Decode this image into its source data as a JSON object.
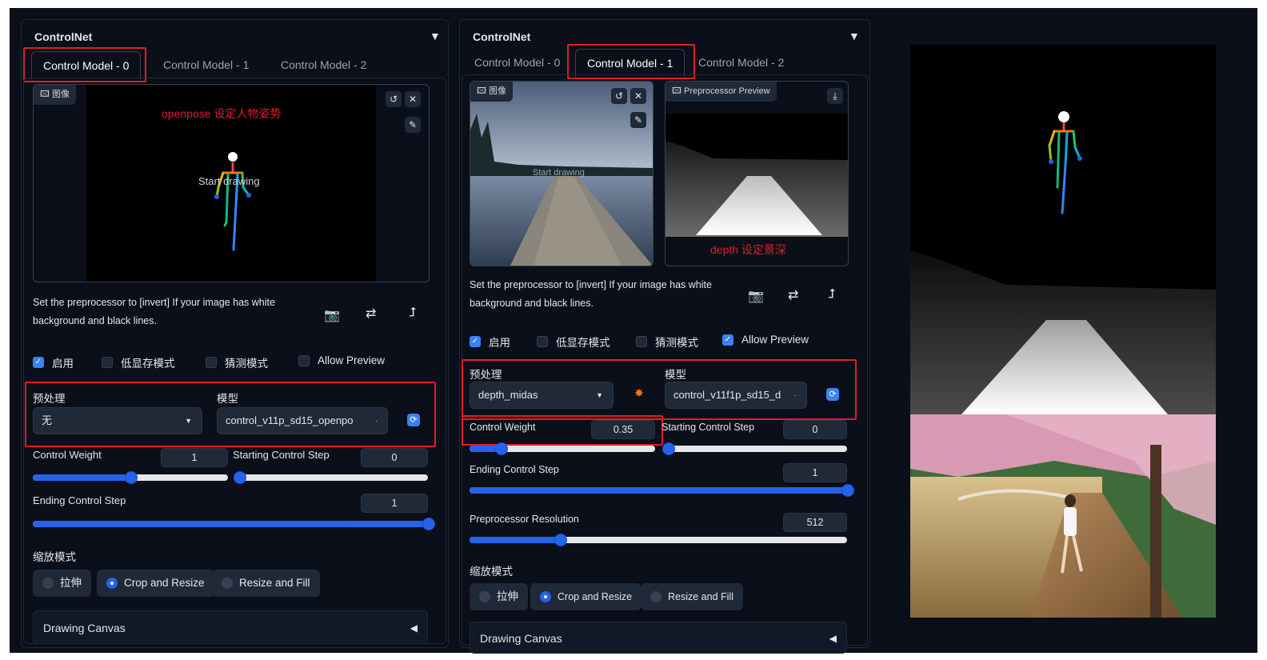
{
  "panel_left": {
    "title": "ControlNet",
    "tabs": [
      "Control Model - 0",
      "Control Model - 1",
      "Control Model - 2"
    ],
    "active_tab": 0,
    "image_label": "图像",
    "overlay_note": "openpose 设定人物姿势",
    "canvas_hint": "Start drawing",
    "hint": "Set the preprocessor to [invert] If your image has white background and black lines.",
    "checks": [
      {
        "label": "启用",
        "checked": true
      },
      {
        "label": "低显存模式",
        "checked": false
      },
      {
        "label": "猜测模式",
        "checked": false
      },
      {
        "label": "Allow Preview",
        "checked": false
      }
    ],
    "preprocessor_label": "预处理",
    "preprocessor_value": "无",
    "model_label": "模型",
    "model_value": "control_v11p_sd15_openpo",
    "control_weight_label": "Control Weight",
    "control_weight": "1",
    "control_weight_fraction": 0.5,
    "start_step_label": "Starting Control Step",
    "start_step": "0",
    "start_step_fraction": 0.0,
    "end_step_label": "Ending Control Step",
    "end_step": "1",
    "end_step_fraction": 1.0,
    "resize_label": "缩放模式",
    "resize_options": [
      "拉伸",
      "Crop and Resize",
      "Resize and Fill"
    ],
    "resize_selected": 1,
    "drawing_canvas": "Drawing Canvas"
  },
  "panel_right": {
    "title": "ControlNet",
    "tabs": [
      "Control Model - 0",
      "Control Model - 1",
      "Control Model - 2"
    ],
    "active_tab": 1,
    "image_label": "图像",
    "preview_label": "Preprocessor Preview",
    "depth_note": "depth 设定景深",
    "canvas_hint": "Start drawing",
    "hint": "Set the preprocessor to [invert] If your image has white background and black lines.",
    "checks": [
      {
        "label": "启用",
        "checked": true
      },
      {
        "label": "低显存模式",
        "checked": false
      },
      {
        "label": "猜测模式",
        "checked": false
      },
      {
        "label": "Allow Preview",
        "checked": true
      }
    ],
    "preprocessor_label": "预处理",
    "preprocessor_value": "depth_midas",
    "model_label": "模型",
    "model_value": "control_v11f1p_sd15_d",
    "control_weight_label": "Control Weight",
    "control_weight": "0.35",
    "control_weight_fraction": 0.17,
    "start_step_label": "Starting Control Step",
    "start_step": "0",
    "start_step_fraction": 0.0,
    "end_step_label": "Ending Control Step",
    "end_step": "1",
    "end_step_fraction": 1.0,
    "resolution_label": "Preprocessor Resolution",
    "resolution": "512",
    "resolution_fraction": 0.24,
    "resize_label": "缩放模式",
    "resize_options": [
      "拉伸",
      "Crop and Resize",
      "Resize and Fill"
    ],
    "resize_selected": 1,
    "drawing_canvas": "Drawing Canvas"
  },
  "colors": {
    "bg": "#0b0f19",
    "accent": "#2563eb",
    "highlight": "#e11d2a"
  },
  "icons": [
    "image-icon",
    "undo-icon",
    "close-icon",
    "brush-icon",
    "camera-icon",
    "swap-icon",
    "upload-arrow-icon",
    "download-icon",
    "refresh-icon",
    "explosion-icon",
    "collapse-triangle-icon"
  ]
}
